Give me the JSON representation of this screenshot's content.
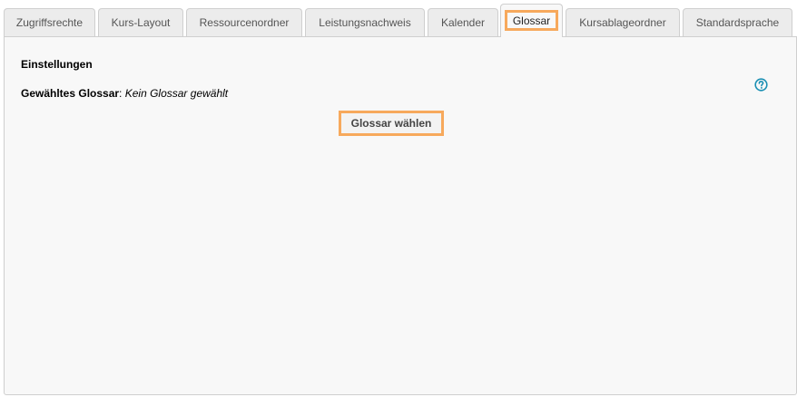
{
  "tabs": [
    {
      "label": "Zugriffsrechte"
    },
    {
      "label": "Kurs-Layout"
    },
    {
      "label": "Ressourcenordner"
    },
    {
      "label": "Leistungsnachweis"
    },
    {
      "label": "Kalender"
    },
    {
      "label": "Glossar"
    },
    {
      "label": "Kursablageordner"
    },
    {
      "label": "Standardsprache"
    }
  ],
  "active_tab": "Glossar",
  "section": {
    "title": "Einstellungen",
    "field_label": "Gewähltes Glossar",
    "field_separator": ":",
    "field_value": "Kein Glossar gewählt",
    "button_label": "Glossar wählen"
  },
  "icons": {
    "help": "question-circle"
  },
  "colors": {
    "highlight": "#f7a95c",
    "help_icon": "#1a8fb3"
  }
}
